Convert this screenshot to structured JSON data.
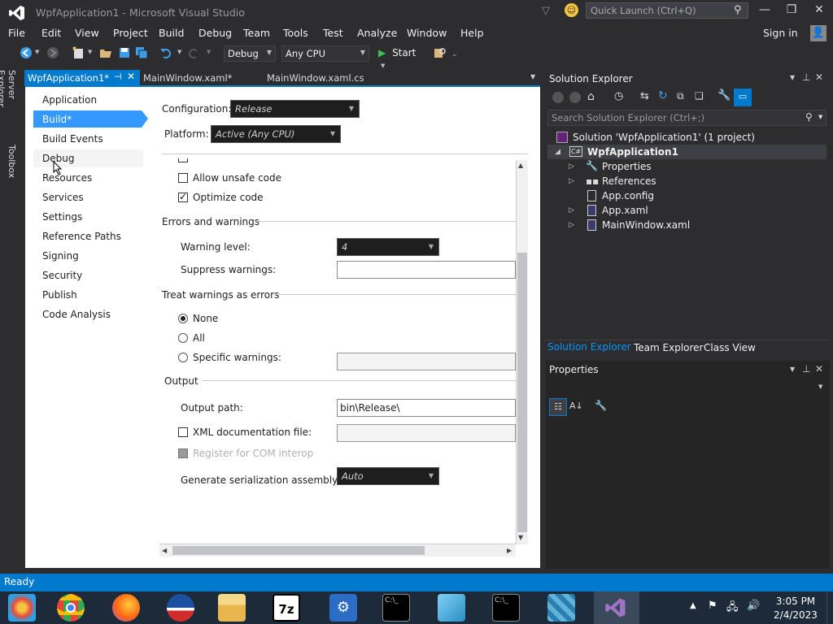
{
  "window": {
    "title": "WpfApplication1 - Microsoft Visual Studio",
    "quick_launch_placeholder": "Quick Launch (Ctrl+Q)",
    "sign_in": "Sign in"
  },
  "menu": [
    "File",
    "Edit",
    "View",
    "Project",
    "Build",
    "Debug",
    "Team",
    "Tools",
    "Test",
    "Analyze",
    "Window",
    "Help"
  ],
  "toolbar": {
    "config": "Debug",
    "platform": "Any CPU",
    "start": "Start"
  },
  "side_tabs": [
    "Server Explorer",
    "Toolbox"
  ],
  "doc_tabs": {
    "active": "WpfApplication1*",
    "tab2": "MainWindow.xaml*",
    "tab3": "MainWindow.xaml.cs"
  },
  "nav": {
    "items": [
      "Application",
      "Build*",
      "Build Events",
      "Debug",
      "Resources",
      "Services",
      "Settings",
      "Reference Paths",
      "Signing",
      "Security",
      "Publish",
      "Code Analysis"
    ]
  },
  "build": {
    "configuration_label": "Configuration:",
    "configuration_value": "Release",
    "platform_label": "Platform:",
    "platform_value": "Active (Any CPU)",
    "allow_unsafe": "Allow unsafe code",
    "optimize": "Optimize code",
    "errors_header": "Errors and warnings",
    "warning_level_label": "Warning level:",
    "warning_level_value": "4",
    "suppress_label": "Suppress warnings:",
    "treat_header": "Treat warnings as errors",
    "none": "None",
    "all": "All",
    "specific": "Specific warnings:",
    "output_header": "Output",
    "output_path_label": "Output path:",
    "output_path_value": "bin\\Release\\",
    "xml_doc": "XML documentation file:",
    "com_interop": "Register for COM interop",
    "serialization_label": "Generate serialization assembly:",
    "serialization_value": "Auto"
  },
  "solution_explorer": {
    "title": "Solution Explorer",
    "search_placeholder": "Search Solution Explorer (Ctrl+;)",
    "solution": "Solution 'WpfApplication1' (1 project)",
    "project": "WpfApplication1",
    "items": [
      "Properties",
      "References",
      "App.config",
      "App.xaml",
      "MainWindow.xaml"
    ],
    "tabs": [
      "Solution Explorer",
      "Team Explorer",
      "Class View"
    ]
  },
  "properties_title": "Properties",
  "status": "Ready",
  "clock": {
    "time": "3:05 PM",
    "date": "2/4/2023"
  }
}
